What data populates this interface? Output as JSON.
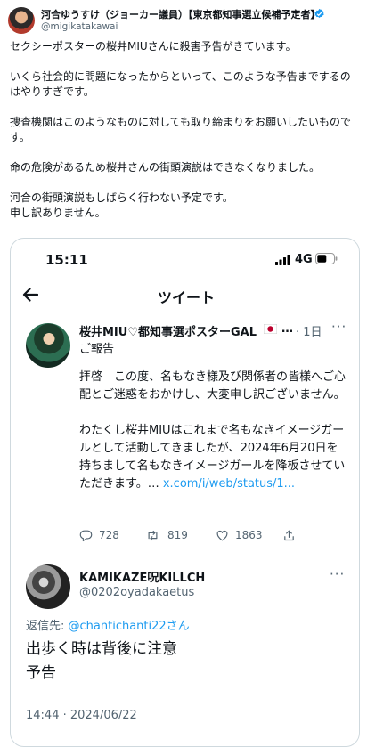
{
  "outer_tweet": {
    "name": "河合ゆうすけ（ジョーカー議員）【東京都知事選立候補予定者】",
    "handle": "@migikatakawai",
    "paragraphs": [
      "セクシーポスターの桜井MIUさんに殺害予告がきています。",
      "いくら社会的に問題になったからといって、このような予告までするのはやりすぎです。",
      "捜査機関はこのようなものに対しても取り締まりをお願いしたいものです。",
      "命の危険があるため桜井さんの街頭演説はできなくなりました。",
      "河合の街頭演説もしばらく行わない予定です。\n申し訳ありません。"
    ]
  },
  "phone_screenshot": {
    "status_bar": {
      "time": "15:11",
      "network": "4G"
    },
    "nav": {
      "title": "ツイート"
    },
    "quoted_tweet": {
      "name": "桜井MIU♡都知事選ポスターGAL",
      "ellipsis": "…",
      "date": "· 1日",
      "more": "···",
      "label": "ご報告",
      "body": [
        "拝啓　この度、名もなき様及び関係者の皆様へご心配とご迷惑をおかけし、大変申し訳ございません。",
        "わたくし桜井MIUはこれまで名もなきイメージガールとして活動してきましたが、2024年6月20日を持ちまして名もなきイメージガールを降板させていただきます。…"
      ],
      "link": "x.com/i/web/status/1...",
      "actions": {
        "replies": "728",
        "retweets": "819",
        "likes": "1863"
      }
    },
    "reply": {
      "name": "KAMIKAZE呪KILLCH",
      "handle": "@0202oyadakaetus",
      "more": "···",
      "replying_prefix": "返信先: ",
      "replying_to": "@chantichanti22さん",
      "text": "出歩く時は背後に注意\n予告",
      "date": "14:44 · 2024/06/22"
    }
  },
  "colors": {
    "accent": "#1d9bf0",
    "secondary_text": "#536471",
    "border": "#cfd9de"
  }
}
